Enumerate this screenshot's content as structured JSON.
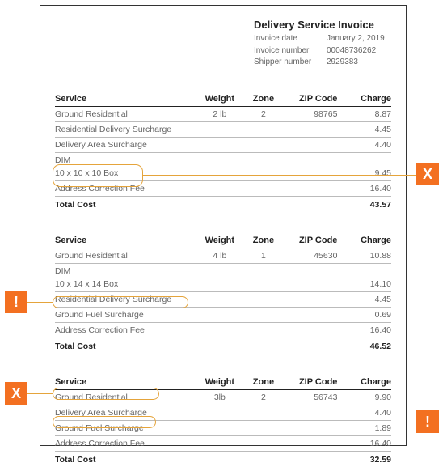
{
  "header": {
    "title": "Delivery Service Invoice",
    "rows": [
      {
        "label": "Invoice date",
        "value": "January 2, 2019"
      },
      {
        "label": "Invoice number",
        "value": "00048736262"
      },
      {
        "label": "Shipper number",
        "value": "2929383"
      }
    ]
  },
  "columns": {
    "service": "Service",
    "weight": "Weight",
    "zone": "Zone",
    "zip": "ZIP Code",
    "charge": "Charge"
  },
  "total_label": "Total Cost",
  "sections": [
    {
      "rows": [
        {
          "service": "Ground Residential",
          "weight": "2 lb",
          "zone": "2",
          "zip": "98765",
          "charge": "8.87"
        },
        {
          "service": "Residential Delivery Surcharge",
          "charge": "4.45"
        },
        {
          "service": "Delivery Area Surcharge",
          "charge": "4.40"
        },
        {
          "service": "DIM",
          "sub": "10 x 10 x 10 Box",
          "charge": "9.45"
        },
        {
          "service": "Address Correction Fee",
          "charge": "16.40"
        }
      ],
      "total": "43.57"
    },
    {
      "rows": [
        {
          "service": "Ground Residential",
          "weight": "4 lb",
          "zone": "1",
          "zip": "45630",
          "charge": "10.88"
        },
        {
          "service": "DIM",
          "sub": "10 x 14 x 14 Box",
          "charge": "14.10"
        },
        {
          "service": "Residential Delivery Surcharge",
          "charge": "4.45"
        },
        {
          "service": "Ground Fuel Surcharge",
          "charge": "0.69"
        },
        {
          "service": "Address Correction Fee",
          "charge": "16.40"
        }
      ],
      "total": "46.52"
    },
    {
      "rows": [
        {
          "service": "Ground Residential",
          "weight": "3lb",
          "zone": "2",
          "zip": "56743",
          "charge": "9.90"
        },
        {
          "service": "Delivery Area Surcharge",
          "charge": "4.40"
        },
        {
          "service": "Ground Fuel Surcharge",
          "charge": "1.89"
        },
        {
          "service": "Address Correction Fee",
          "charge": "16.40"
        }
      ],
      "total": "32.59"
    }
  ],
  "annotations": {
    "x": "X",
    "excl": "!"
  }
}
